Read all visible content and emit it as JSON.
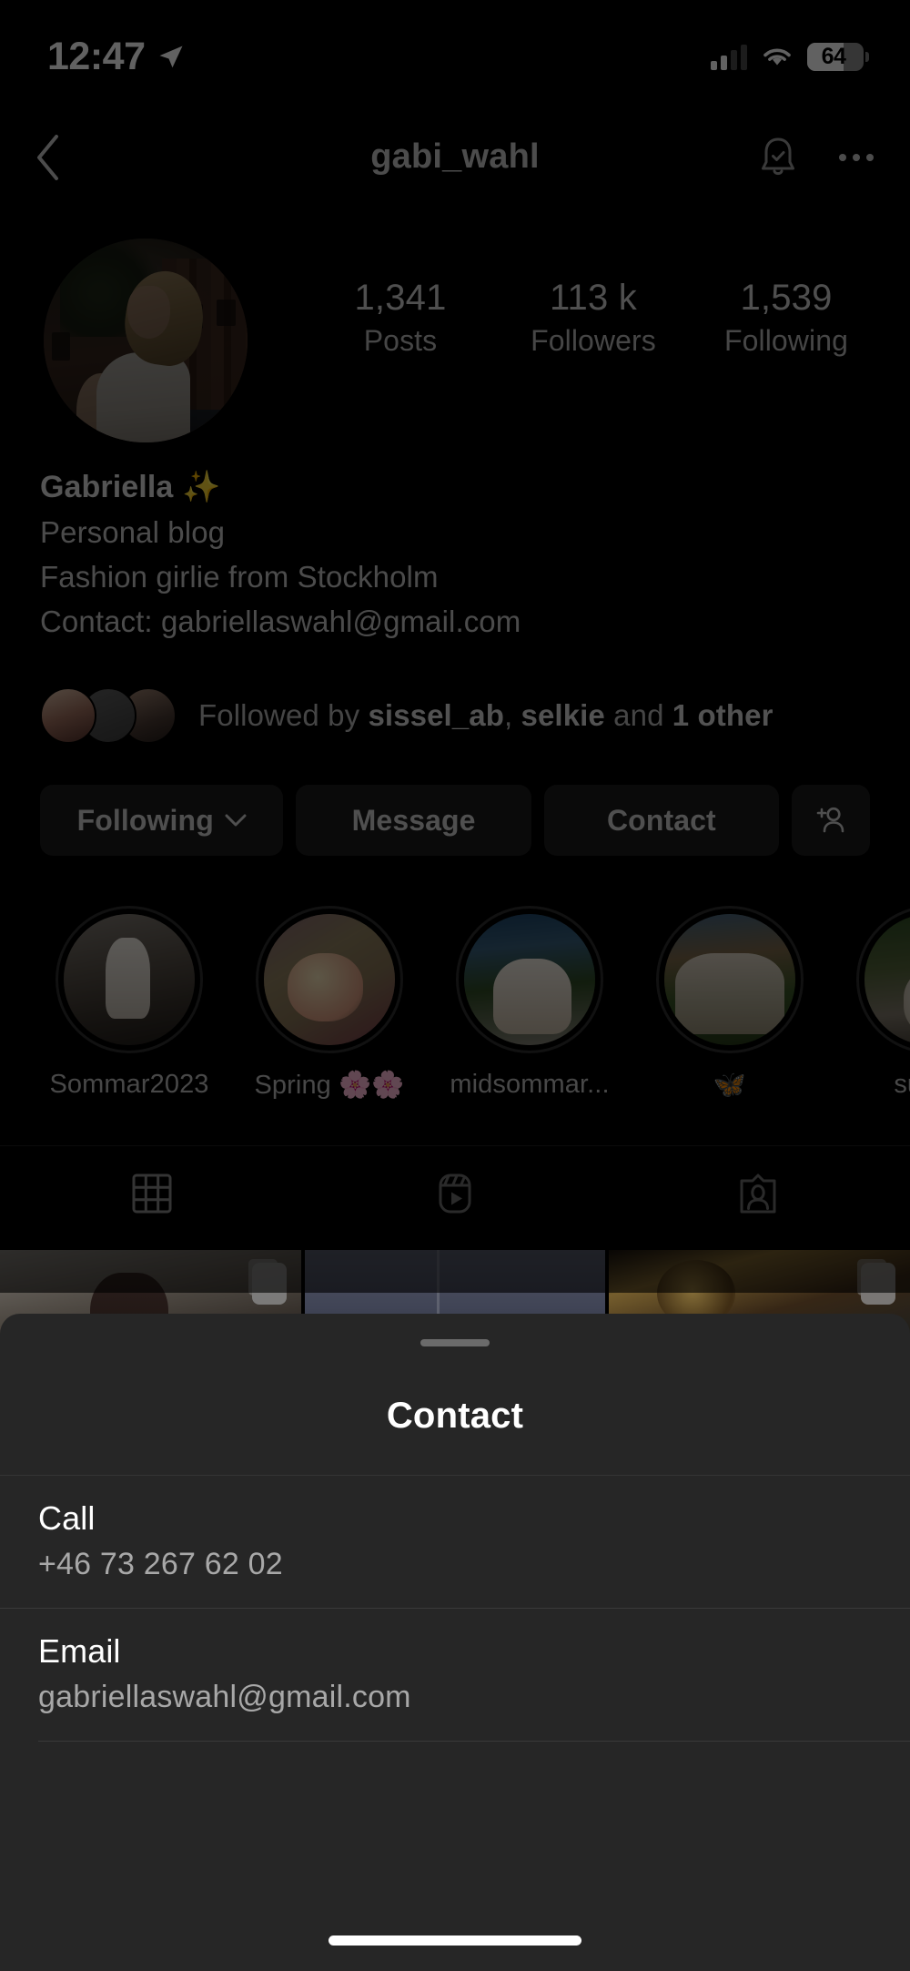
{
  "status_bar": {
    "time": "12:47",
    "location_icon": "location-arrow-icon",
    "signal_icon": "cellular-signal-icon",
    "signal_bars_filled": 2,
    "signal_bars_total": 4,
    "wifi_icon": "wifi-icon",
    "battery_level": "64",
    "battery_percent": 64
  },
  "nav": {
    "back_icon": "back-chevron-icon",
    "title": "gabi_wahl",
    "notify_icon": "bell-check-icon",
    "more_icon": "more-options-icon"
  },
  "profile": {
    "avatar_alt": "profile-photo",
    "stats": [
      {
        "value": "1,341",
        "label": "Posts"
      },
      {
        "value": "113 k",
        "label": "Followers"
      },
      {
        "value": "1,539",
        "label": "Following"
      }
    ],
    "display_name": "Gabriella",
    "name_emoji": "✨",
    "category": "Personal blog",
    "bio_line_2": "Fashion girlie from Stockholm",
    "bio_line_3": "Contact: gabriellaswahl@gmail.com"
  },
  "followed_by": {
    "prefix": "Followed by ",
    "user_1": "sissel_ab",
    "separator": ", ",
    "user_2": "selkie",
    "connector": " and ",
    "others": "1 other"
  },
  "actions": {
    "following_label": "Following",
    "following_chevron": "chevron-down-icon",
    "message_label": "Message",
    "contact_label": "Contact",
    "add_user_icon": "add-person-icon"
  },
  "highlights": [
    {
      "label": "Sommar2023",
      "cover": "hc1"
    },
    {
      "label": "Spring 🌸🌸",
      "cover": "hc2"
    },
    {
      "label": "midsommar...",
      "cover": "hc3"
    },
    {
      "label": "🦋",
      "cover": "hc4"
    },
    {
      "label": "summ",
      "cover": "hc5"
    }
  ],
  "tabs": [
    {
      "name": "grid",
      "icon": "grid-icon",
      "active": true
    },
    {
      "name": "reels",
      "icon": "reels-icon",
      "active": false
    },
    {
      "name": "tagged",
      "icon": "tagged-icon",
      "active": false
    }
  ],
  "posts": [
    {
      "cover": "p1",
      "carousel": true
    },
    {
      "cover": "p2",
      "carousel": false
    },
    {
      "cover": "p3",
      "carousel": true
    }
  ],
  "sheet": {
    "grabber": "drag-handle",
    "title": "Contact",
    "rows": [
      {
        "label": "Call",
        "value": "+46 73 267 62 02"
      },
      {
        "label": "Email",
        "value": "gabriellaswahl@gmail.com"
      }
    ]
  },
  "colors": {
    "background": "#000000",
    "sheet_background": "#262626",
    "button_background": "#1b1b1b",
    "primary_text": "#ffffff",
    "secondary_text": "#a8a8a8",
    "sparkle": "#e0b84b"
  }
}
